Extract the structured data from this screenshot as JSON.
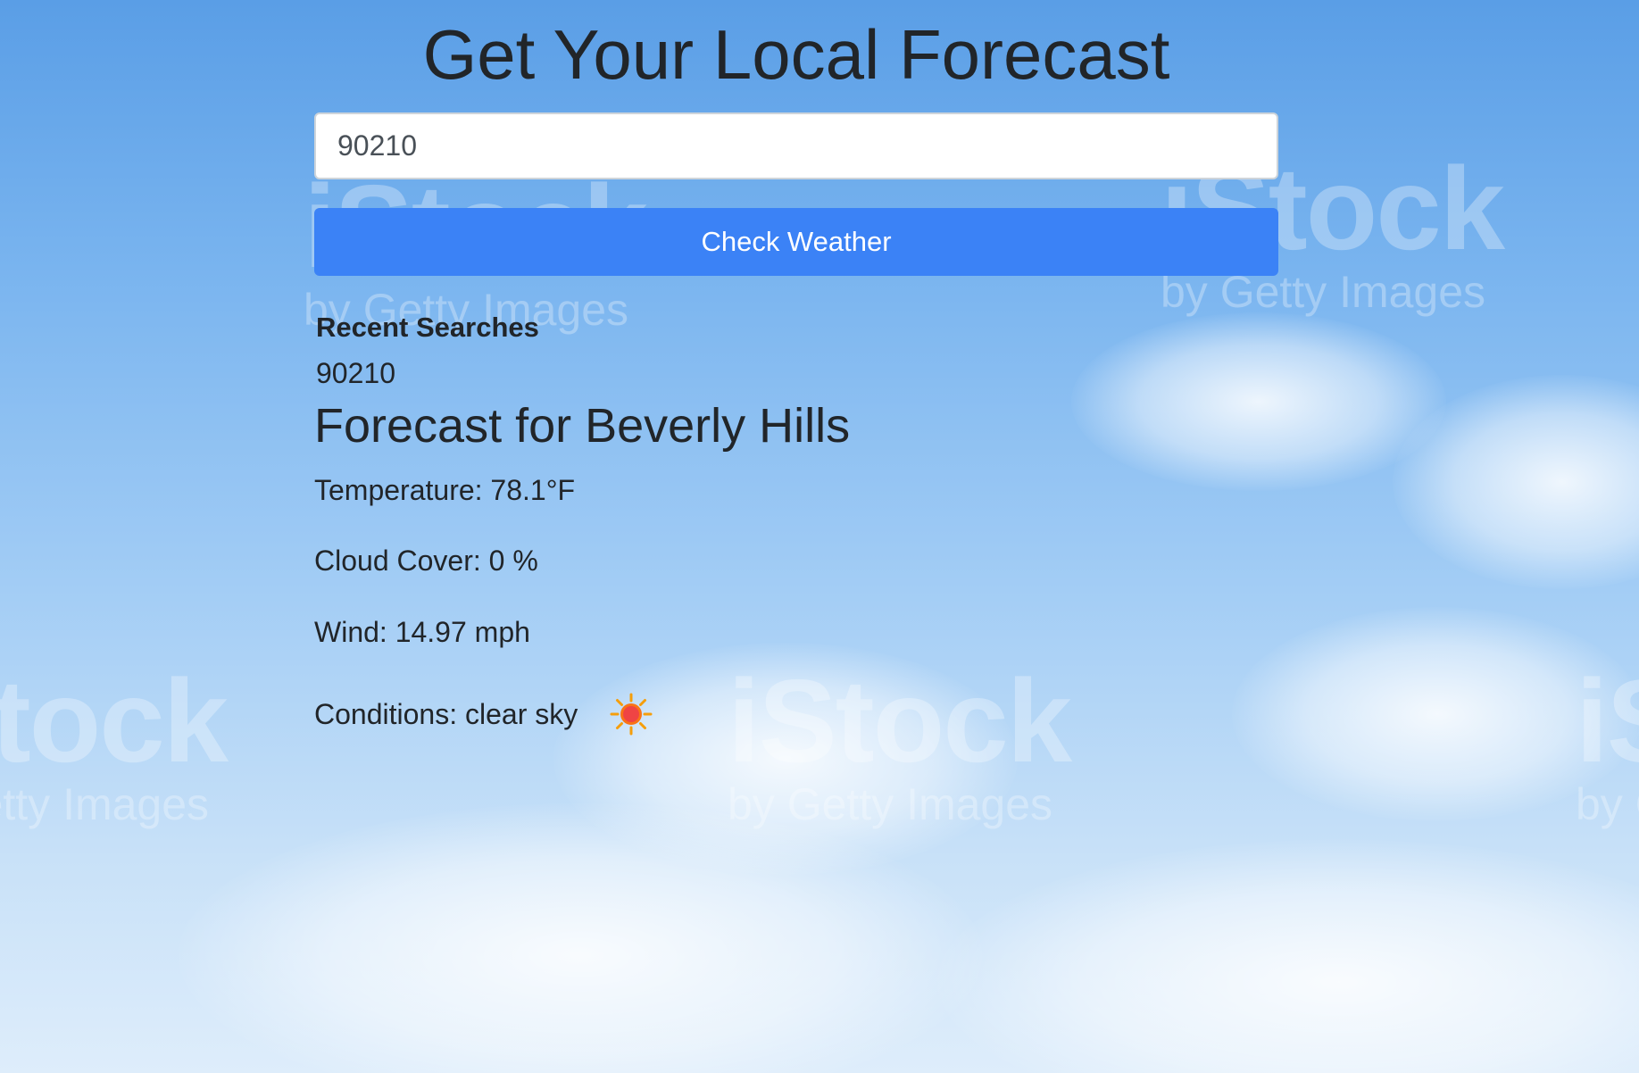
{
  "header": {
    "title": "Get Your Local Forecast"
  },
  "search": {
    "value": "90210",
    "button_label": "Check Weather"
  },
  "recent": {
    "title": "Recent Searches",
    "items": [
      "90210"
    ]
  },
  "forecast": {
    "title": "Forecast for Beverly Hills",
    "temperature": "Temperature: 78.1°F",
    "cloud_cover": "Cloud Cover: 0 %",
    "wind": "Wind: 14.97 mph",
    "conditions": "Conditions: clear sky",
    "conditions_icon": "sun-icon"
  },
  "background": {
    "watermark_text": "iStock",
    "watermark_subtext": "by Getty Images"
  },
  "colors": {
    "button": "#3b82f6",
    "text": "#212529"
  }
}
